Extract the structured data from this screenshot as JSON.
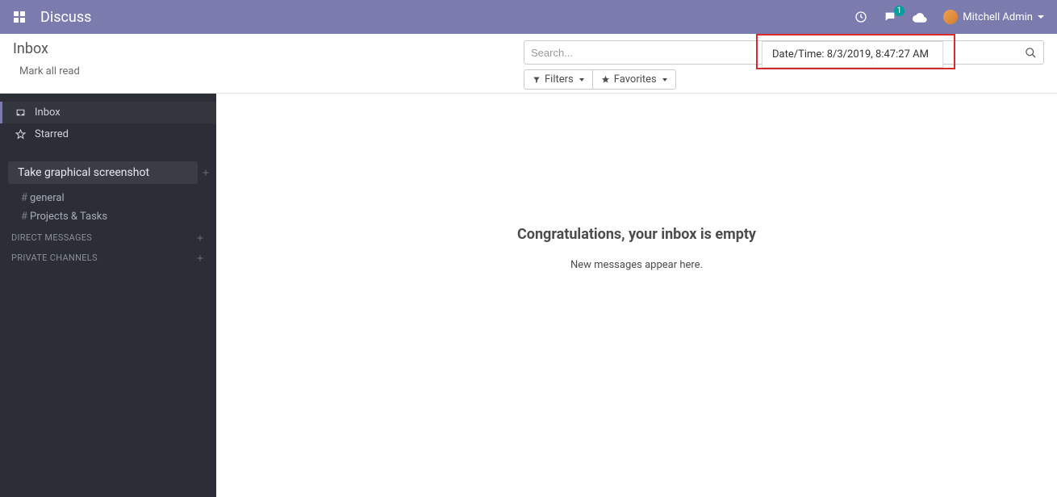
{
  "navbar": {
    "app_title": "Discuss",
    "message_badge": "1",
    "user_name": "Mitchell Admin"
  },
  "control_panel": {
    "breadcrumb": "Inbox",
    "mark_all_read": "Mark all read",
    "search_placeholder": "Search...",
    "filters_label": "Filters",
    "favorites_label": "Favorites"
  },
  "datetime_popup": {
    "text": "Date/Time: 8/3/2019, 8:47:27 AM"
  },
  "sidebar": {
    "inbox": "Inbox",
    "starred": "Starred",
    "screenshot_pill": "Take graphical screenshot",
    "channels": [
      {
        "name": "general"
      },
      {
        "name": "Projects & Tasks"
      }
    ],
    "direct_messages_label": "DIRECT MESSAGES",
    "private_channels_label": "PRIVATE CHANNELS"
  },
  "content": {
    "empty_title": "Congratulations, your inbox is empty",
    "empty_sub": "New messages appear here."
  }
}
